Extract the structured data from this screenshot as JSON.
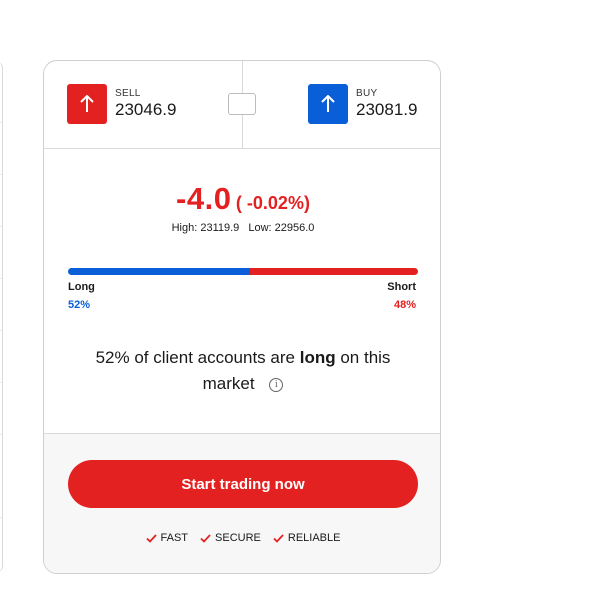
{
  "quote": {
    "sell": {
      "label": "SELL",
      "price": "23046.9"
    },
    "buy": {
      "label": "BUY",
      "price": "23081.9"
    }
  },
  "change": {
    "value": "-4.0",
    "percent": "( -0.02%)"
  },
  "range": {
    "high": "High: 23119.9",
    "low": "Low: 22956.0"
  },
  "sentiment": {
    "long_label": "Long",
    "short_label": "Short",
    "long_pct": "52%",
    "short_pct": "48%",
    "long_fraction": 0.52,
    "short_fraction": 0.48
  },
  "summary": {
    "pct": "52%",
    "text_a": "of client accounts are",
    "emph": "long",
    "text_b": "on this market"
  },
  "cta": {
    "label": "Start trading now"
  },
  "features": [
    "FAST",
    "SECURE",
    "RELIABLE"
  ],
  "colors": {
    "sell": "#e32120",
    "buy": "#0a5ed8"
  },
  "icons": {
    "sell": "arrow-up-icon",
    "buy": "arrow-up-icon",
    "info": "info-icon",
    "check": "check-icon"
  }
}
